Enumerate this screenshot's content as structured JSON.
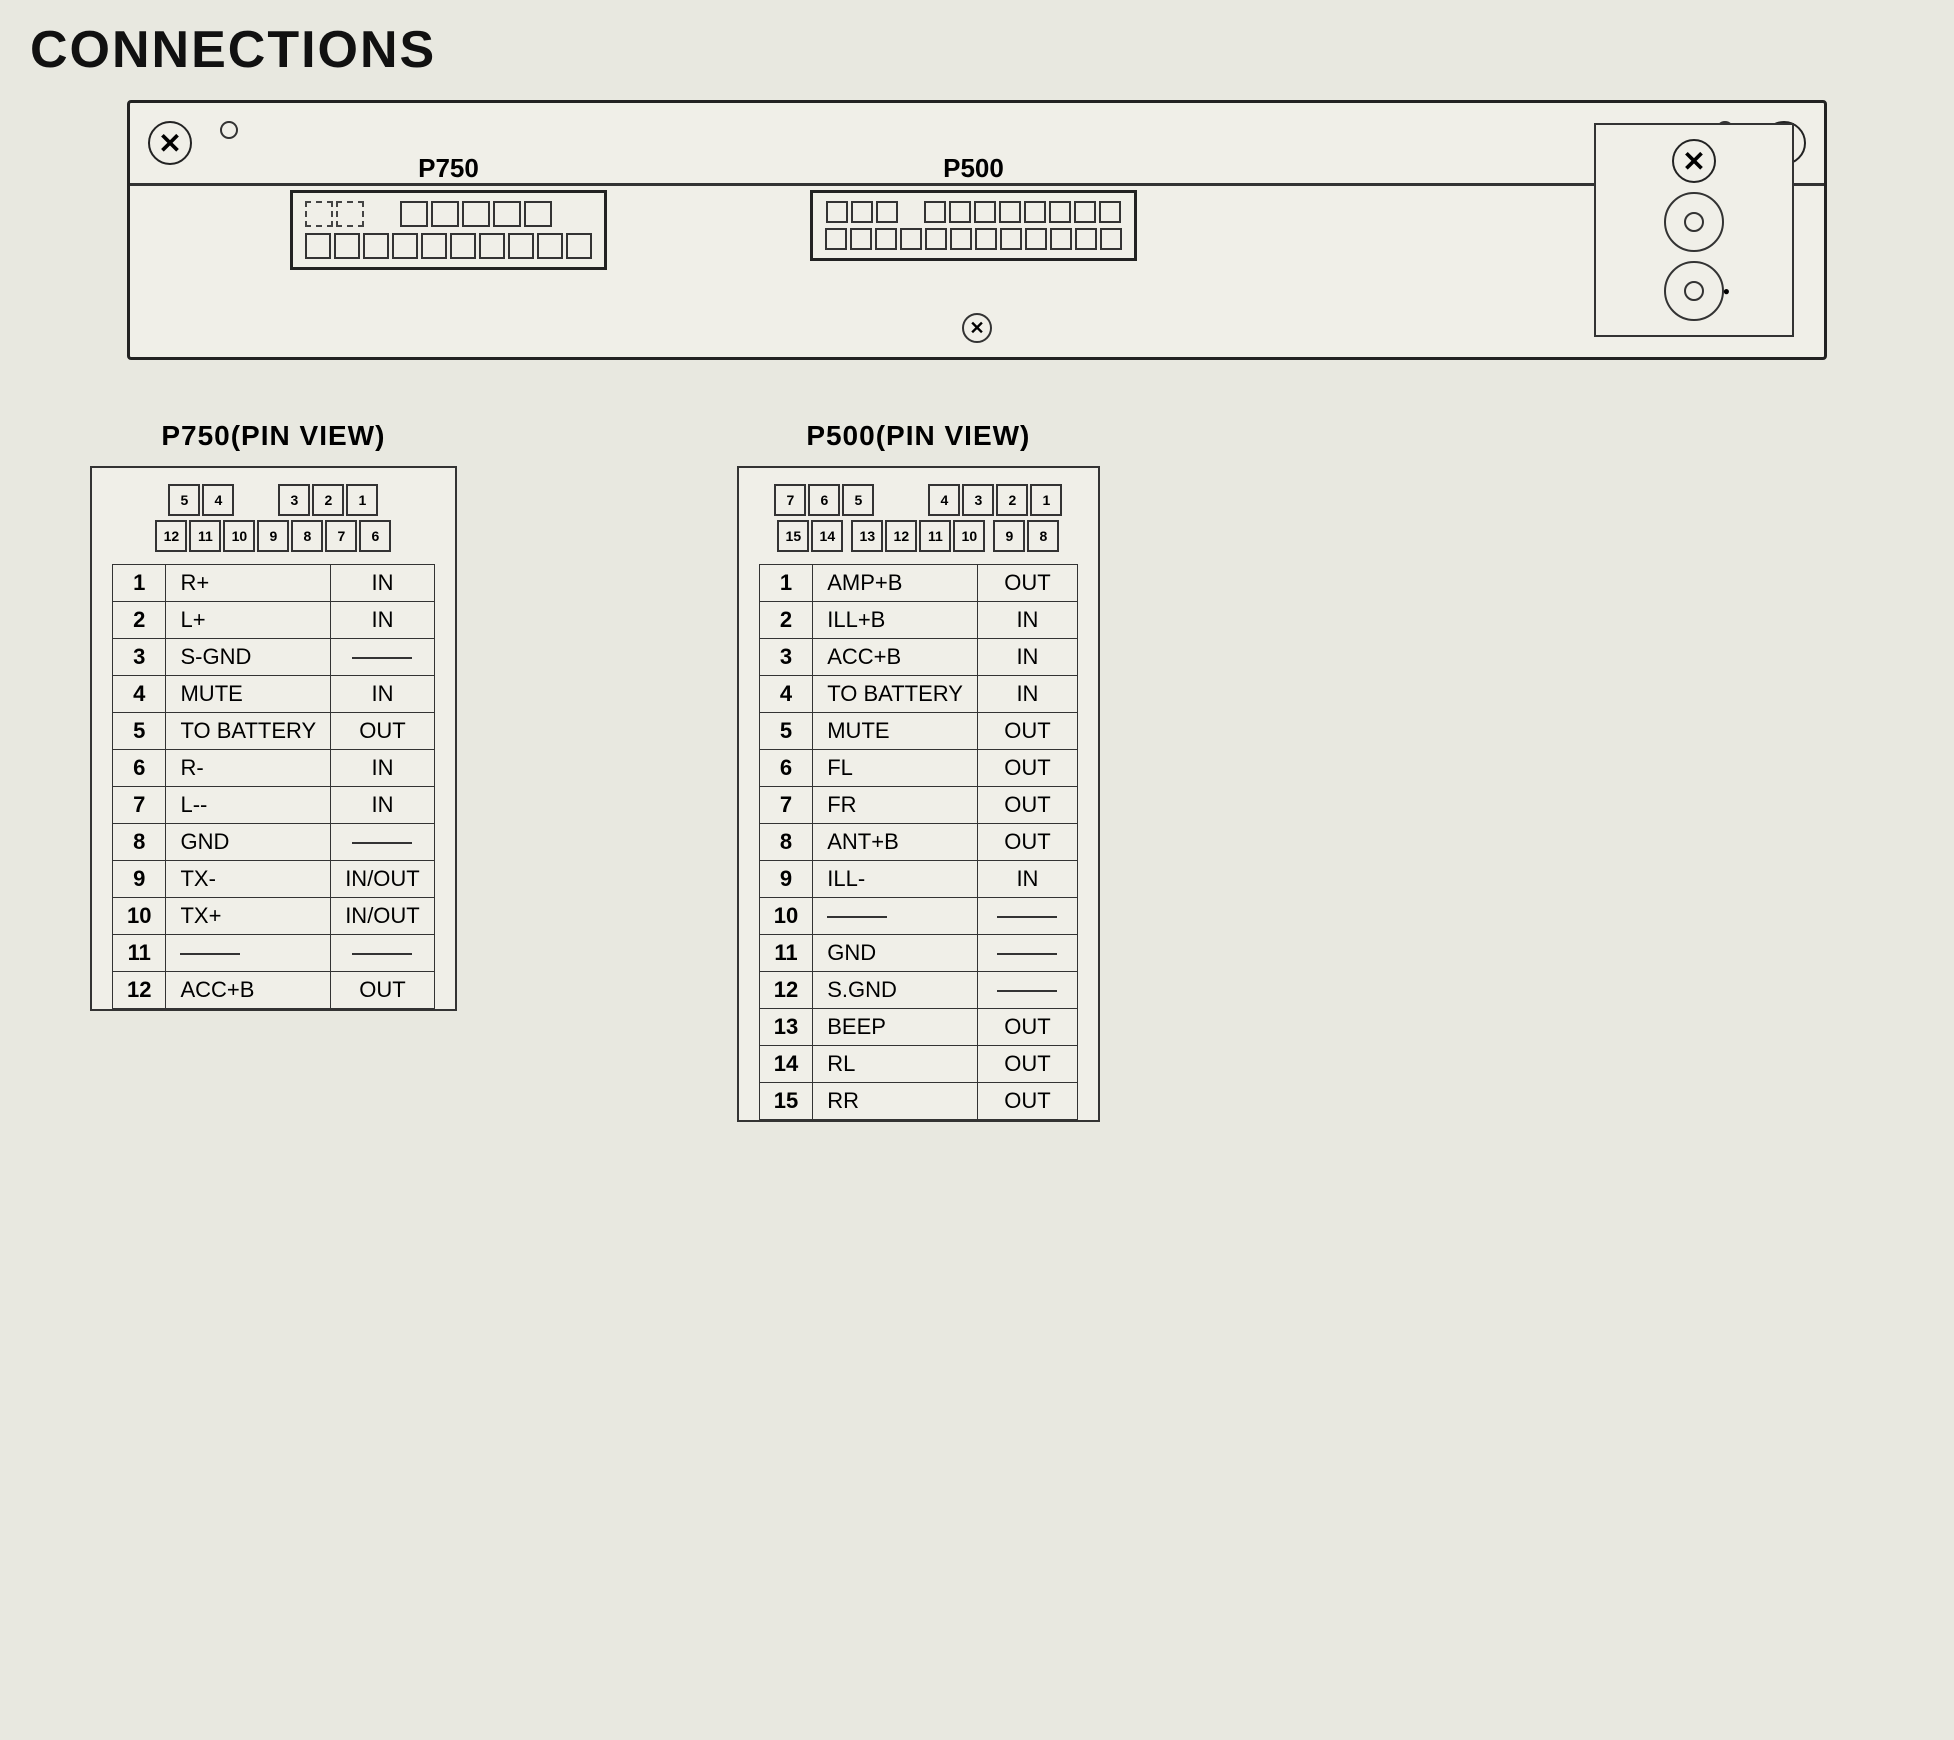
{
  "title": "CONNECTIONS",
  "unit": {
    "connector_p750_label": "P750",
    "connector_p500_label": "P500"
  },
  "p750_pin_view": {
    "title": "P750(PIN VIEW)",
    "top_row": [
      "5",
      "4",
      "",
      "3",
      "2",
      "1"
    ],
    "bottom_row": [
      "12",
      "11",
      "10",
      "9",
      "8",
      "7",
      "6"
    ],
    "pins": [
      {
        "num": "1",
        "signal": "R+",
        "dir": "IN"
      },
      {
        "num": "2",
        "signal": "L+",
        "dir": "IN"
      },
      {
        "num": "3",
        "signal": "S-GND",
        "dir": "—"
      },
      {
        "num": "4",
        "signal": "MUTE",
        "dir": "IN"
      },
      {
        "num": "5",
        "signal": "TO BATTERY",
        "dir": "OUT"
      },
      {
        "num": "6",
        "signal": "R-",
        "dir": "IN"
      },
      {
        "num": "7",
        "signal": "L--",
        "dir": "IN"
      },
      {
        "num": "8",
        "signal": "GND",
        "dir": "—"
      },
      {
        "num": "9",
        "signal": "TX-",
        "dir": "IN/OUT"
      },
      {
        "num": "10",
        "signal": "TX+",
        "dir": "IN/OUT"
      },
      {
        "num": "11",
        "signal": "—",
        "dir": "—"
      },
      {
        "num": "12",
        "signal": "ACC+B",
        "dir": "OUT"
      }
    ]
  },
  "p500_pin_view": {
    "title": "P500(PIN VIEW)",
    "top_row": [
      "7",
      "6",
      "5",
      "",
      "4",
      "3",
      "2",
      "1"
    ],
    "bottom_row": [
      "15",
      "14",
      "",
      "13",
      "12",
      "11",
      "10",
      "",
      "9",
      "8"
    ],
    "pins": [
      {
        "num": "1",
        "signal": "AMP+B",
        "dir": "OUT"
      },
      {
        "num": "2",
        "signal": "ILL+B",
        "dir": "IN"
      },
      {
        "num": "3",
        "signal": "ACC+B",
        "dir": "IN"
      },
      {
        "num": "4",
        "signal": "TO BATTERY",
        "dir": "IN"
      },
      {
        "num": "5",
        "signal": "MUTE",
        "dir": "OUT"
      },
      {
        "num": "6",
        "signal": "FL",
        "dir": "OUT"
      },
      {
        "num": "7",
        "signal": "FR",
        "dir": "OUT"
      },
      {
        "num": "8",
        "signal": "ANT+B",
        "dir": "OUT"
      },
      {
        "num": "9",
        "signal": "ILL-",
        "dir": "IN"
      },
      {
        "num": "10",
        "signal": "—",
        "dir": "—"
      },
      {
        "num": "11",
        "signal": "GND",
        "dir": "—"
      },
      {
        "num": "12",
        "signal": "S.GND",
        "dir": "—"
      },
      {
        "num": "13",
        "signal": "BEEP",
        "dir": "OUT"
      },
      {
        "num": "14",
        "signal": "RL",
        "dir": "OUT"
      },
      {
        "num": "15",
        "signal": "RR",
        "dir": "OUT"
      }
    ]
  }
}
